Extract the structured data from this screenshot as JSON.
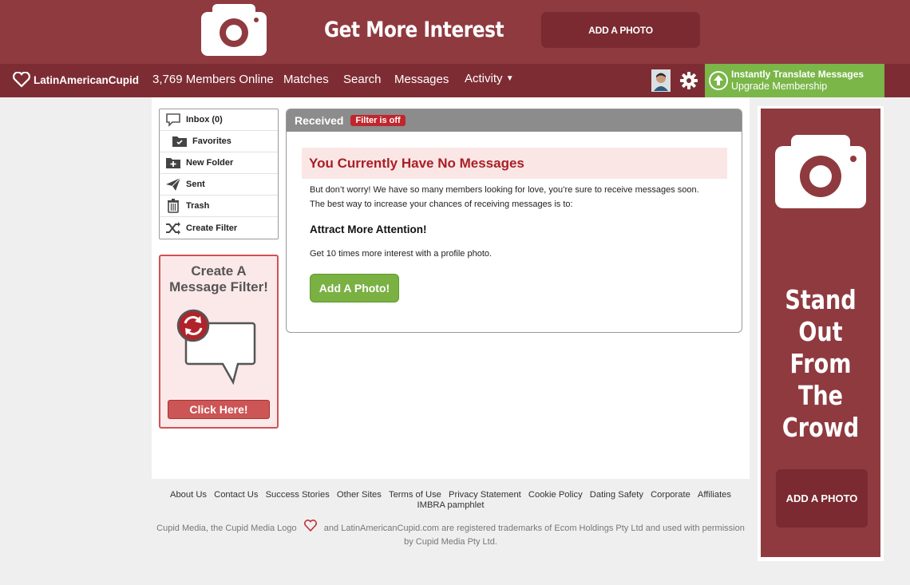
{
  "banner": {
    "headline": "Get More Interest",
    "add_photo_label": "ADD A PHOTO"
  },
  "nav": {
    "logo_text": "LatinAmericanCupid",
    "members_online": "3,769 Members Online",
    "items": [
      "Matches",
      "Search",
      "Messages",
      "Activity"
    ],
    "upgrade_line1": "Instantly Translate Messages",
    "upgrade_line2": "Upgrade Membership"
  },
  "folders": [
    {
      "label": "Inbox (0)",
      "icon": "inbox-icon"
    },
    {
      "label": "Favorites",
      "icon": "favorites-folder-icon"
    },
    {
      "label": "New Folder",
      "icon": "new-folder-icon"
    },
    {
      "label": "Sent",
      "icon": "paper-plane-icon"
    },
    {
      "label": "Trash",
      "icon": "trash-icon"
    },
    {
      "label": "Create Filter",
      "icon": "shuffle-icon"
    }
  ],
  "filter_promo": {
    "title_line1": "Create A",
    "title_line2": "Message Filter!",
    "cta": "Click Here!"
  },
  "panel": {
    "tab_label": "Received",
    "filter_badge": "Filter is off",
    "no_messages": "You Currently Have No Messages",
    "line1": "But don’t worry! We have so many members looking for love, you’re sure to receive messages soon.",
    "line2": "The best way to increase your chances of receiving messages is to:",
    "attract": "Attract More Attention!",
    "tip": "Get 10 times more interest with a profile photo.",
    "add_photo": "Add A Photo!"
  },
  "side_ad": {
    "line1": "Stand Out",
    "line2": "From The",
    "line3": "Crowd",
    "add_photo_label": "ADD A PHOTO"
  },
  "footer": {
    "links": [
      "About Us",
      "Contact Us",
      "Success Stories",
      "Other Sites",
      "Terms of Use",
      "Privacy Statement",
      "Cookie Policy",
      "Dating Safety",
      "Corporate",
      "Affiliates"
    ],
    "link_second_row": "IMBRA pamphlet",
    "legal_part1": "Cupid Media, the Cupid Media Logo",
    "legal_part2": "and LatinAmericanCupid.com are registered trademarks of Ecom Holdings Pty Ltd and used with permission",
    "legal_part3": "by Cupid Media Pty Ltd."
  },
  "colors": {
    "brand": "#8f3a3f",
    "nav": "#7e2c33",
    "upgrade": "#7ab648",
    "alert": "#a81f24",
    "success_button": "#7bb043"
  }
}
